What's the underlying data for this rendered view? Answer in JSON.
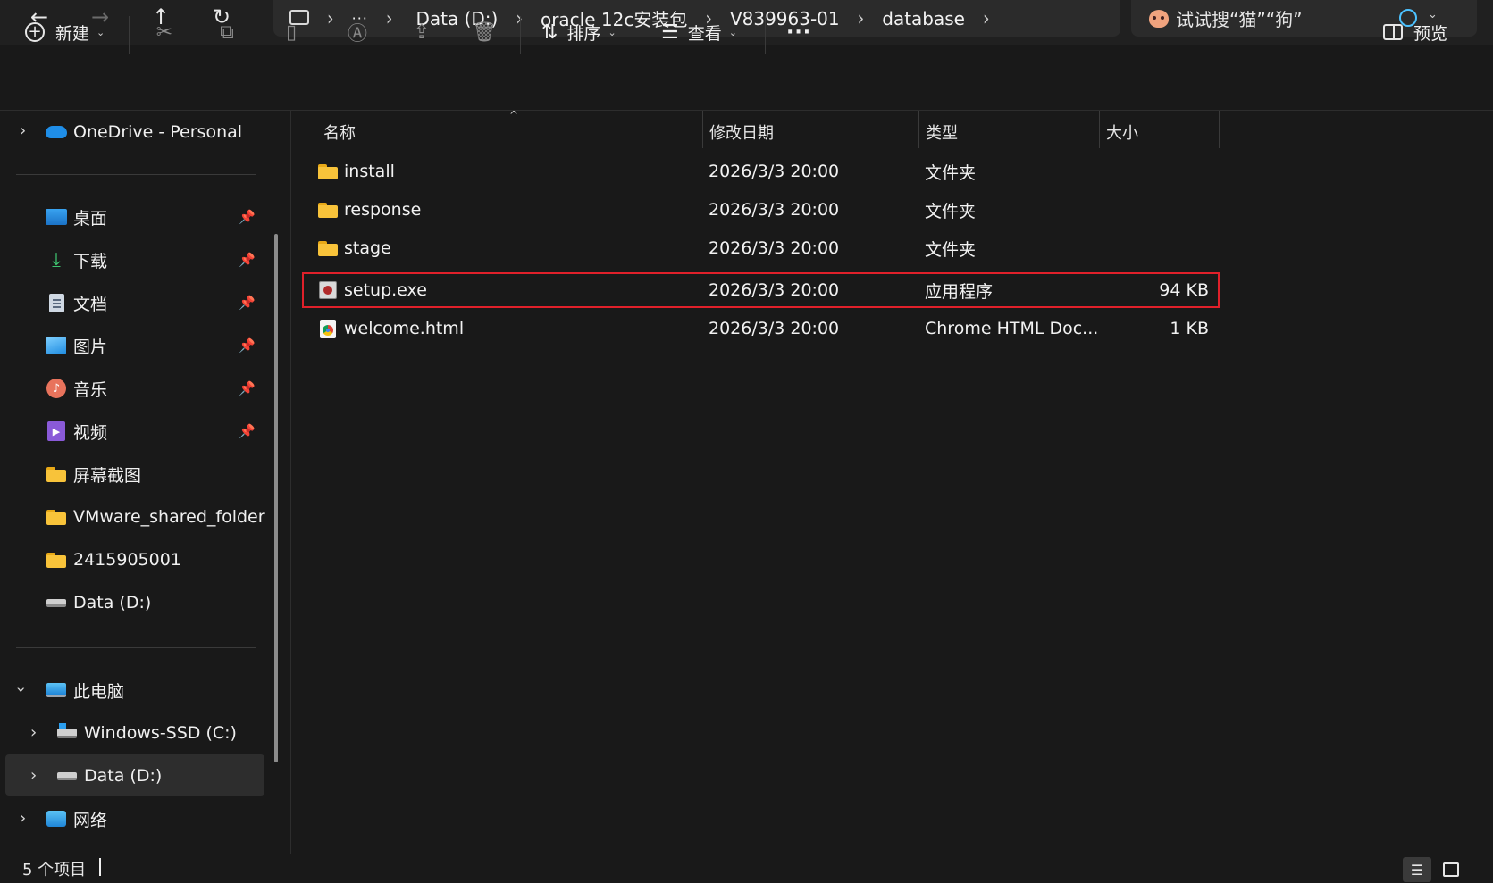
{
  "topbar": {
    "back_icon": "←",
    "forward_icon": "→",
    "up_icon": "↑",
    "refresh_icon": "↻",
    "breadcrumb": [
      "Data (D:)",
      "oracle 12c安装包",
      "V839963-01",
      "database"
    ],
    "more_crumbs": "···",
    "search_placeholder": "试试搜“猫”“狗”"
  },
  "commandbar": {
    "new_label": "新建",
    "sort_label": "排序",
    "view_label": "查看",
    "more_label": "···",
    "preview_label": "预览"
  },
  "nav": {
    "onedrive": "OneDrive - Personal",
    "quick": [
      {
        "label": "桌面",
        "icon": "desktop-icon"
      },
      {
        "label": "下载",
        "icon": "download-icon"
      },
      {
        "label": "文档",
        "icon": "document-icon"
      },
      {
        "label": "图片",
        "icon": "picture-icon"
      },
      {
        "label": "音乐",
        "icon": "music-icon"
      },
      {
        "label": "视频",
        "icon": "video-icon"
      },
      {
        "label": "屏幕截图",
        "icon": "folder-icon"
      },
      {
        "label": "VMware_shared_folder",
        "icon": "folder-icon"
      },
      {
        "label": "2415905001",
        "icon": "folder-icon"
      },
      {
        "label": "Data (D:)",
        "icon": "drive-icon"
      }
    ],
    "this_pc": "此电脑",
    "drive_c": "Windows-SSD (C:)",
    "drive_d": "Data (D:)",
    "network": "网络"
  },
  "columns": {
    "name": "名称",
    "date": "修改日期",
    "type": "类型",
    "size": "大小"
  },
  "files": [
    {
      "name": "install",
      "date": "2026/3/3 20:00",
      "type": "文件夹",
      "size": "",
      "icon": "folder-icon"
    },
    {
      "name": "response",
      "date": "2026/3/3 20:00",
      "type": "文件夹",
      "size": "",
      "icon": "folder-icon"
    },
    {
      "name": "stage",
      "date": "2026/3/3 20:00",
      "type": "文件夹",
      "size": "",
      "icon": "folder-icon"
    },
    {
      "name": "setup.exe",
      "date": "2026/3/3 20:00",
      "type": "应用程序",
      "size": "94 KB",
      "icon": "setup-exe-icon"
    },
    {
      "name": "welcome.html",
      "date": "2026/3/3 20:00",
      "type": "Chrome HTML Doc...",
      "size": "1 KB",
      "icon": "chrome-html-icon"
    }
  ],
  "highlight_color": "#e0202a",
  "status": {
    "item_count": "5 个项目"
  }
}
